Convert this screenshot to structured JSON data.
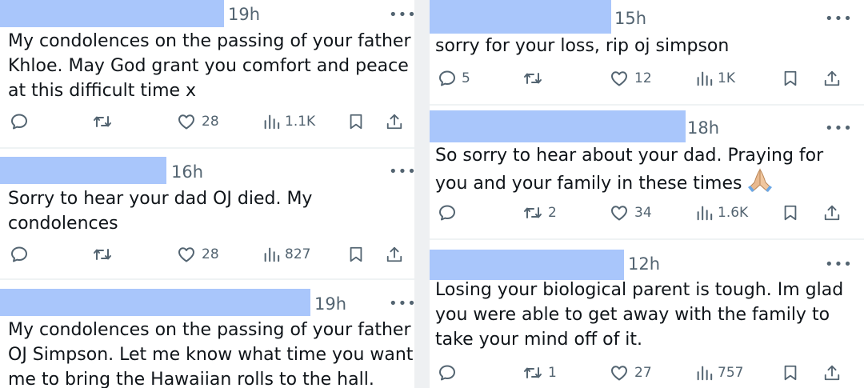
{
  "left_column": {
    "tweets": [
      {
        "time": "19h",
        "more_icon": "ellipsis-icon",
        "lines": [
          "My condolences on the passing of your father",
          "Khloe.  May God grant you comfort and peace",
          "at this difficult time x"
        ],
        "replies": "",
        "retweets": "",
        "likes": "28",
        "views": "1.1K"
      },
      {
        "time": "16h",
        "more_icon": "ellipsis-icon",
        "lines": [
          "Sorry to hear your dad OJ died. My",
          "condolences"
        ],
        "replies": "",
        "retweets": "",
        "likes": "28",
        "views": "827"
      },
      {
        "time": "19h",
        "more_icon": "ellipsis-icon",
        "lines": [
          "My condolences on the passing of your father",
          "OJ Simpson. Let me know what time you want",
          "me to bring the Hawaiian rolls to the hall."
        ]
      }
    ]
  },
  "right_column": {
    "tweets": [
      {
        "time": "15h",
        "more_icon": "ellipsis-icon",
        "lines": [
          "sorry for your loss, rip oj simpson"
        ],
        "replies": "5",
        "retweets": "",
        "likes": "12",
        "views": "1K"
      },
      {
        "time": "18h",
        "more_icon": "ellipsis-icon",
        "lines": [
          "So sorry to hear about your dad. Praying for",
          "you and your family in these times"
        ],
        "emoji": "folded-hands-emoji",
        "replies": "",
        "retweets": "2",
        "likes": "34",
        "views": "1.6K"
      },
      {
        "time": "12h",
        "more_icon": "ellipsis-icon",
        "lines": [
          "Losing your biological parent is tough. Im glad",
          "you were able to get away with the family to",
          "take your mind off of it."
        ],
        "replies": "",
        "retweets": "1",
        "likes": "27",
        "views": "757"
      }
    ]
  },
  "colors": {
    "redaction": "#a9c6fb",
    "text": "#0f1419",
    "secondary": "#536471",
    "divider": "#eff3f4"
  }
}
